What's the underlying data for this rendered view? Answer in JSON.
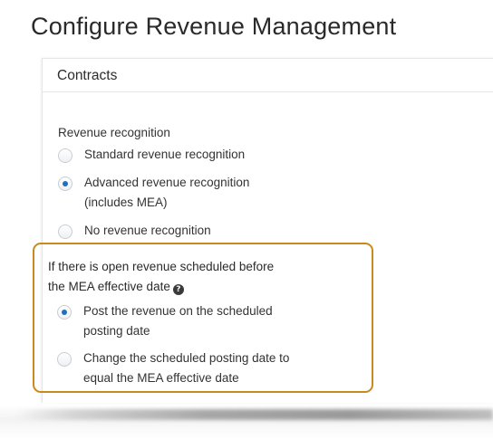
{
  "page": {
    "title": "Configure Revenue Management"
  },
  "panel": {
    "header": "Contracts"
  },
  "revenue_recognition": {
    "label": "Revenue recognition",
    "options": [
      {
        "label_line1": "Standard revenue recognition",
        "label_line2": "",
        "checked": false
      },
      {
        "label_line1": "Advanced revenue recognition",
        "label_line2": "(includes MEA)",
        "checked": true
      },
      {
        "label_line1": "No revenue recognition",
        "label_line2": "",
        "checked": false
      }
    ]
  },
  "open_revenue": {
    "label_line1": "If there is open revenue scheduled before",
    "label_line2": "the MEA effective date",
    "help_icon": "question-circle-icon",
    "help_glyph": "?",
    "options": [
      {
        "label_line1": "Post the revenue on the scheduled",
        "label_line2": "posting date",
        "checked": true
      },
      {
        "label_line1": "Change the scheduled posting date to",
        "label_line2": "equal the MEA effective date",
        "checked": false
      }
    ]
  },
  "colors": {
    "highlight_border": "#c88a1c",
    "radio_selected": "#1f6fbf",
    "text": "#333333"
  }
}
